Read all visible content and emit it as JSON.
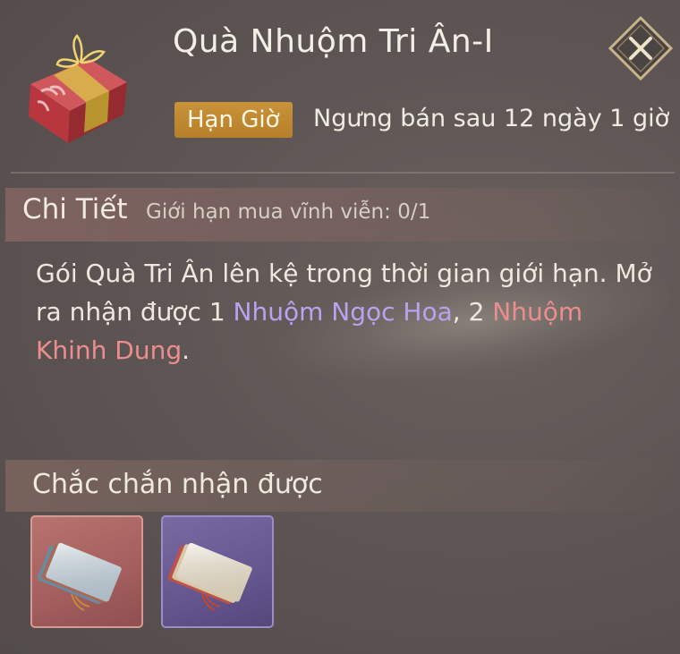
{
  "header": {
    "title": "Quà Nhuộm Tri Ân-I",
    "tag_label": "Hạn Giờ",
    "sale_text": "Ngưng bán sau 12 ngày 1 giờ",
    "icons": {
      "item": "gift-box-icon",
      "close": "close-icon"
    }
  },
  "detail": {
    "title": "Chi Tiết",
    "limit_text": "Giới hạn mua vĩnh viễn: 0/1",
    "desc": {
      "part1": "Gói Quà Tri Ân lên kệ trong thời gian giới hạn. Mở ra nhận được 1 ",
      "item1": "Nhuộm Ngọc Hoa",
      "part2": ", 2 ",
      "item2": "Nhuộm Khinh Dung",
      "part3": "."
    }
  },
  "guaranteed": {
    "title": "Chắc chắn nhận được",
    "items": [
      {
        "icon": "dye-cards-icon",
        "rarity_color": "#a35e5d"
      },
      {
        "icon": "dye-cards-icon",
        "rarity_color": "#65568f"
      }
    ]
  },
  "colors": {
    "accent_tag": "#c08a33",
    "item_purple_text": "#b8a4ee",
    "item_red_text": "#ec8d8e"
  }
}
